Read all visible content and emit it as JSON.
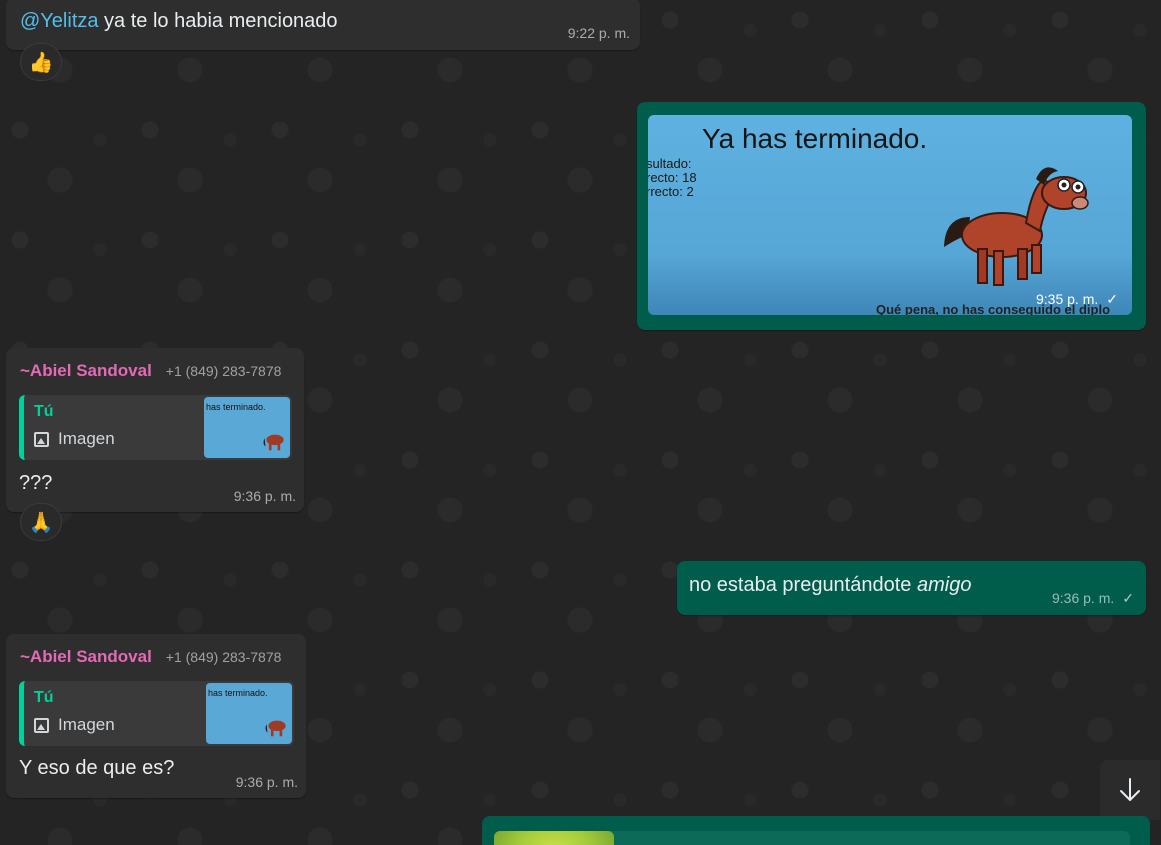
{
  "messages": {
    "m1": {
      "mention": "@Yelitza",
      "text": " ya te lo habia mencionado",
      "time": "9:22 p. m.",
      "reaction": "👍"
    },
    "m2": {
      "title": "Ya has terminado.",
      "result_lines": [
        "sultado:",
        "recto: 18",
        "rrecto: 2"
      ],
      "footer": "Qué pena, no has conseguido el diplo",
      "time": "9:35 p. m.",
      "check": "✓"
    },
    "m3": {
      "sender": "~Abiel Sandoval",
      "phone": "+1 (849) 283-7878",
      "quote_author": "Tú",
      "quote_kind": "Imagen",
      "quote_thumb_text": "has terminado.",
      "text": "???",
      "time": "9:36 p. m.",
      "reaction": "🙏"
    },
    "m4": {
      "text_plain": "no estaba preguntándote ",
      "text_italic": "amigo",
      "time": "9:36 p. m.",
      "check": "✓"
    },
    "m5": {
      "sender": "~Abiel Sandoval",
      "phone": "+1 (849) 283-7878",
      "quote_author": "Tú",
      "quote_kind": "Imagen",
      "quote_thumb_text": "has terminado.",
      "text": "Y eso de que es?",
      "time": "9:36 p. m."
    }
  },
  "icons": {
    "scroll_down": "arrow-down-icon",
    "image": "image-icon",
    "check": "single-check-icon"
  },
  "colors": {
    "incoming_bubble": "#2e2e2e",
    "outgoing_bubble": "#005c4b",
    "mention": "#53bdeb",
    "sender": "#e26ab6",
    "quote_accent": "#06cf9c"
  }
}
